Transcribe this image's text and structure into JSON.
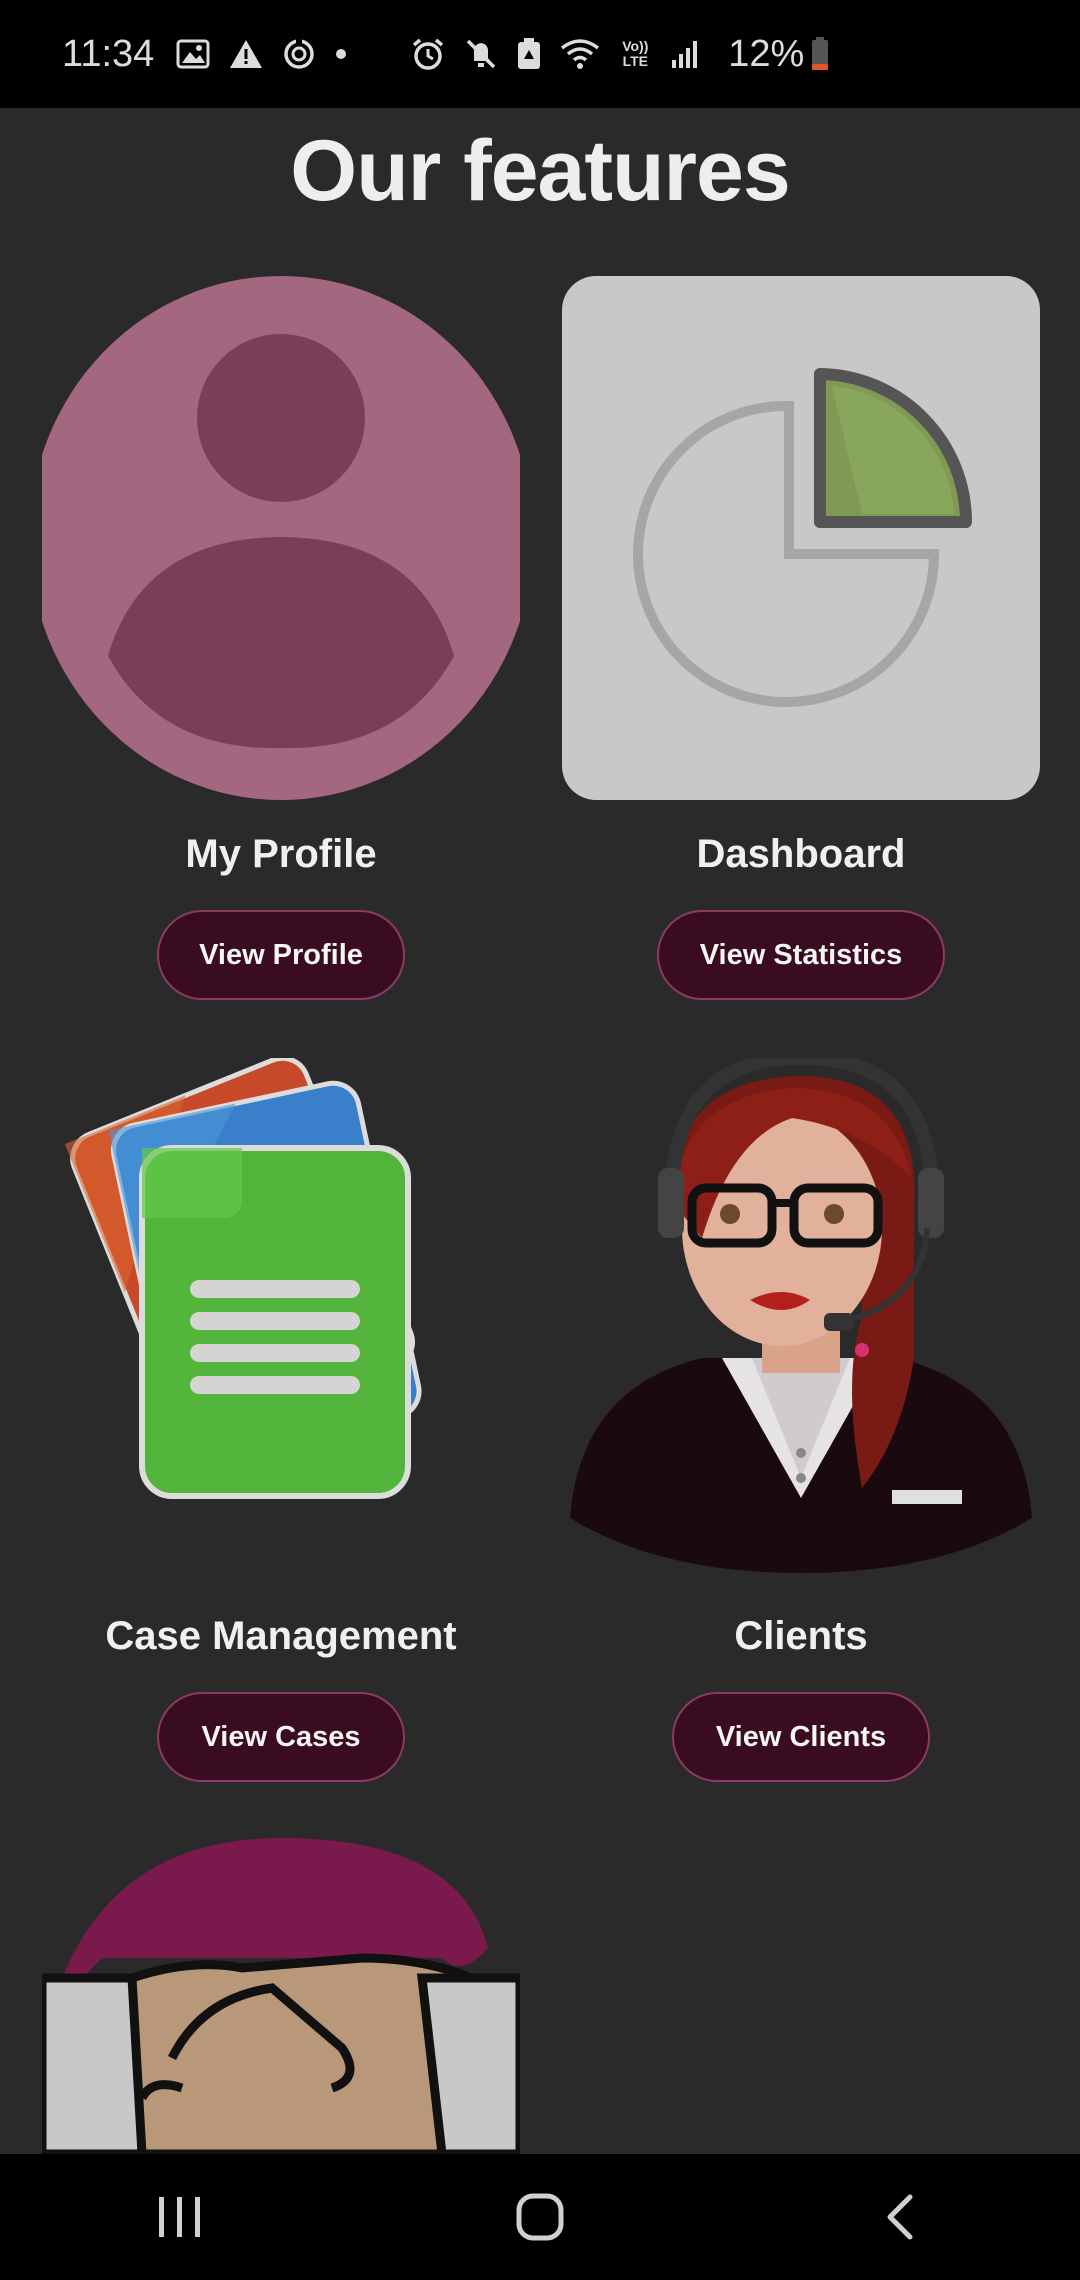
{
  "status_bar": {
    "time": "11:34",
    "battery": "12%",
    "left_icons": [
      "image-icon",
      "warning-icon",
      "sync-icon",
      "dot-icon"
    ],
    "right_icons": [
      "alarm-icon",
      "mute-icon",
      "battery-saver-icon",
      "wifi-icon",
      "volte-icon",
      "signal-icon",
      "battery-icon"
    ],
    "volte_label": "Vo)) LTE"
  },
  "title": "Our features",
  "features": [
    {
      "label": "My Profile",
      "button": "View Profile",
      "image": "profile-avatar-icon"
    },
    {
      "label": "Dashboard",
      "button": "View Statistics",
      "image": "pie-chart-icon"
    },
    {
      "label": "Case Management",
      "button": "View Cases",
      "image": "documents-icon"
    },
    {
      "label": "Clients",
      "button": "View Clients",
      "image": "support-agent-icon"
    },
    {
      "label": "",
      "button": "",
      "image": "handshake-icon"
    }
  ],
  "nav_bar": {
    "items": [
      "recent-apps-icon",
      "home-icon",
      "back-icon"
    ]
  },
  "colors": {
    "background": "#2a2a2a",
    "button_bg": "#3a0c1f",
    "button_border": "#8a3a63",
    "profile_bg": "#a3687f",
    "profile_fg": "#7a3e58"
  }
}
